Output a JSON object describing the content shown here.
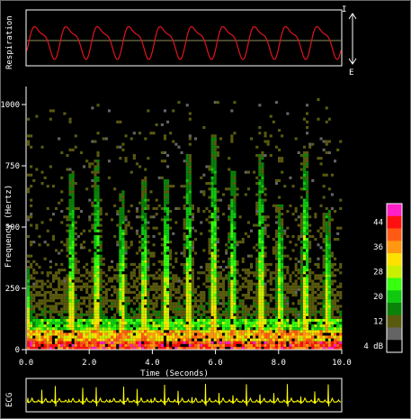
{
  "chart_data": [
    {
      "type": "line",
      "panel": "respiration",
      "ylabel": "Respiration",
      "markers": {
        "top": "I",
        "bottom": "E"
      },
      "series": [
        {
          "color": "#e0141e",
          "cycles": 10
        }
      ],
      "baseline_color": "#8b8b5a"
    },
    {
      "type": "heatmap",
      "panel": "spectrogram",
      "xlabel": "Time (Seconds)",
      "ylabel": "Frequency (Hertz)",
      "xlim": [
        0,
        10
      ],
      "ylim": [
        0,
        1000
      ],
      "xticks": [
        "0.0",
        "2.0",
        "4.0",
        "6.0",
        "8.0",
        "10.0"
      ],
      "yticks": [
        "0",
        "250",
        "500",
        "750",
        "1000"
      ],
      "burst_times": [
        0.0,
        1.4,
        2.2,
        3.0,
        3.7,
        4.4,
        5.1,
        5.9,
        6.5,
        7.4,
        8.0,
        8.8,
        9.5
      ],
      "burst_peak_hz": [
        350,
        720,
        780,
        660,
        700,
        700,
        800,
        880,
        730,
        820,
        600,
        810,
        600
      ],
      "colorbar": {
        "labels": [
          "44",
          "36",
          "28",
          "20",
          "12",
          "4 dB"
        ],
        "colors": [
          "#ff20c8",
          "#ff1010",
          "#ff5a14",
          "#ff9810",
          "#ffe100",
          "#c8f000",
          "#36ff10",
          "#10c810",
          "#0a820a",
          "#5a5a0f",
          "#646464",
          "#000000"
        ]
      }
    },
    {
      "type": "line",
      "panel": "ecg",
      "ylabel": "ECG",
      "series": [
        {
          "color": "#ffff00",
          "beats": 23
        }
      ]
    }
  ]
}
